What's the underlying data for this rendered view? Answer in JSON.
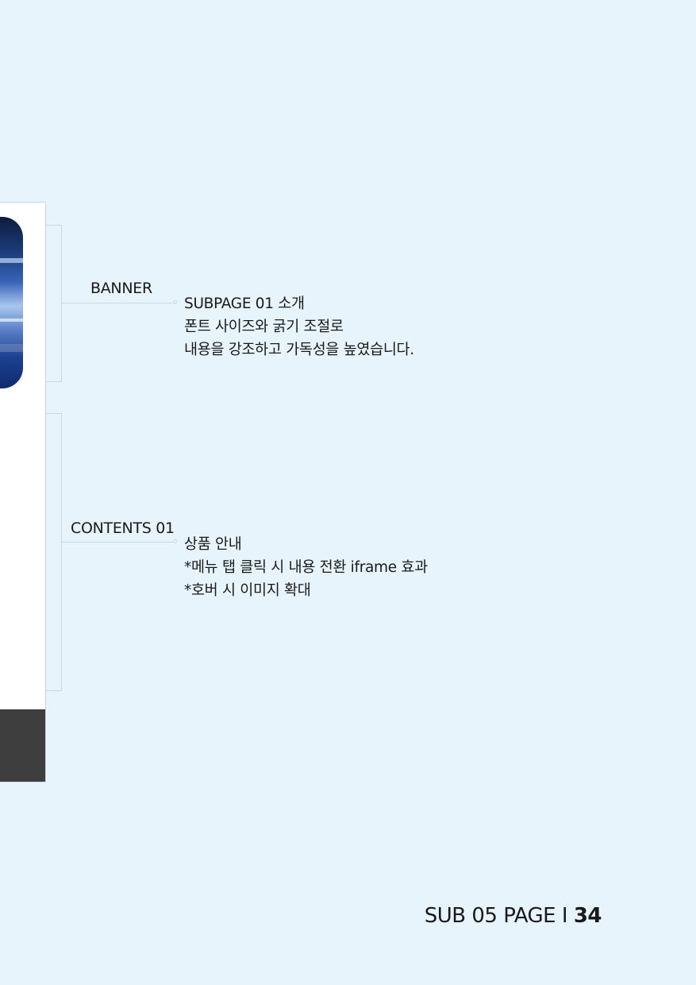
{
  "annotations": [
    {
      "label": "BANNER",
      "lines": [
        "SUBPAGE 01 소개",
        "폰트 사이즈와 굵기 조절로",
        "내용을 강조하고 가독성을 높였습니다."
      ]
    },
    {
      "label": "CONTENTS 01",
      "lines": [
        "상품 안내",
        "*메뉴 탭 클릭 시 내용 전환 iframe 효과",
        "*호버 시 이미지 확대"
      ]
    }
  ],
  "footer": {
    "page_label": "SUB 05 PAGE I ",
    "page_number": "34"
  },
  "colors": {
    "background": "#e8f4fb",
    "connector": "#c9d8e2",
    "mock_footer": "#3e3e3e",
    "text": "#1a1a1a"
  }
}
